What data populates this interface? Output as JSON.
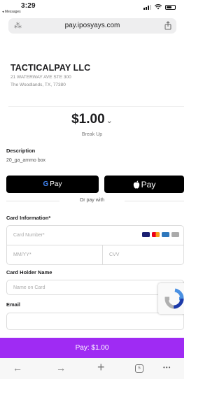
{
  "status_bar": {
    "time": "3:29",
    "back_app": "◂ Messages"
  },
  "browser": {
    "url": "pay.iposyays.com"
  },
  "merchant": {
    "name": "TACTICALPAY LLC",
    "address_line1": "21 WATERWAY AVE STE 300",
    "address_line2": "The Woodlands, TX, 77380"
  },
  "payment": {
    "amount": "$1.00",
    "amount_caret": "⌄",
    "tip_label": "Break Up"
  },
  "description": {
    "label": "Description",
    "value": "20_ga_ammo box"
  },
  "wallets": {
    "google_pay_letter": "G",
    "google_pay_text": "Pay",
    "apple_pay_text": "Pay",
    "apple_glyph": ""
  },
  "divider_text": "Or pay with",
  "card": {
    "label": "Card Information*",
    "number_placeholder": "Card Number*",
    "expiry_placeholder": "MM/YY*",
    "cvv_placeholder": "CVV",
    "brand_colors": [
      "#1a1f71",
      "#eb001b",
      "#2e77bc",
      "#aaaaaa"
    ]
  },
  "holder": {
    "label": "Card Holder Name",
    "placeholder": "Name on Card"
  },
  "email": {
    "label": "Email",
    "placeholder": ""
  },
  "pay_button": {
    "label": "Pay: $1.00",
    "color": "#9f2bf3"
  },
  "toolbar": {
    "back": "←",
    "forward": "→",
    "new_tab": "+",
    "tabs_count": "5",
    "more": "•••"
  }
}
